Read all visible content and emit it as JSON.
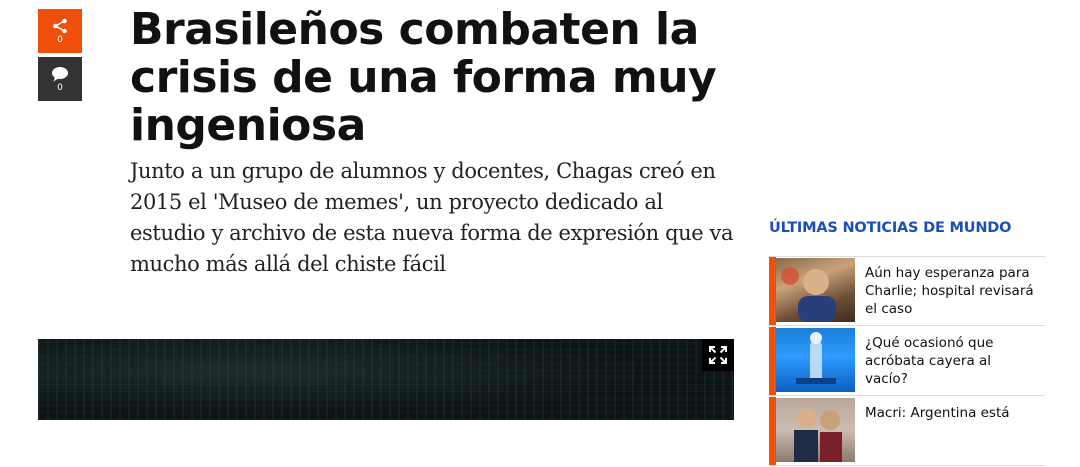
{
  "share_rail": {
    "share": {
      "icon": "share-icon",
      "count": "0"
    },
    "comments": {
      "icon": "comment-icon",
      "count": "0"
    }
  },
  "article": {
    "headline": "Brasileños combaten la crisis de una forma muy ingeniosa",
    "dek": "Junto a un grupo de alumnos y docentes, Chagas creó en 2015 el 'Museo de memes', un proyecto dedicado al estudio y archivo de esta nueva forma de expresión que va mucho más allá del chiste fácil"
  },
  "video": {
    "expand_icon": "expand-icon"
  },
  "sidebar": {
    "title": "ÚLTIMAS NOTICIAS DE MUNDO",
    "items": [
      {
        "title": "Aún hay esperanza para Charlie; hospital revisará el caso"
      },
      {
        "title": "¿Qué ocasionó que acróbata cayera al vacío?"
      },
      {
        "title": "Macri: Argentina está"
      }
    ]
  },
  "colors": {
    "accent": "#f04f0a",
    "link_blue": "#1a4fb8",
    "comment_bg": "#333333"
  }
}
